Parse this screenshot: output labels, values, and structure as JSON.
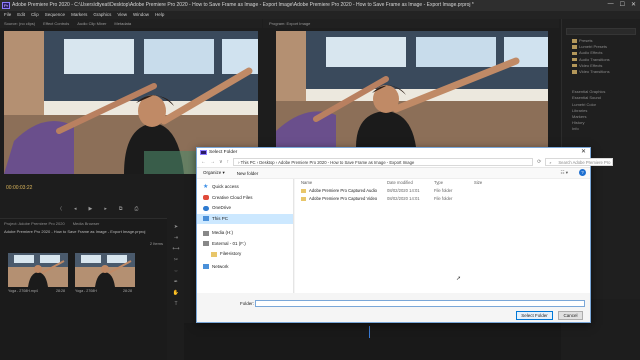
{
  "window": {
    "title": "Adobe Premiere Pro 2020 - C:\\Users\\dtyeat\\Desktop\\Adobe Premiere Pro 2020 - How to Save Frame as Image - Export Image\\Adobe Premiere Pro 2020 - How to Save Frame as Image - Export Image.prproj *",
    "app_icon": "Pr",
    "controls": [
      "—",
      "☐",
      "✕"
    ]
  },
  "menu": [
    "File",
    "Edit",
    "Clip",
    "Sequence",
    "Markers",
    "Graphics",
    "View",
    "Window",
    "Help"
  ],
  "source_monitor": {
    "tabs": [
      "Source: (no clips)",
      "Effect Controls",
      "Audio Clip Mixer",
      "Metadata"
    ],
    "timecode": "00:00:03:22"
  },
  "program_monitor": {
    "tabs": [
      "Program: Export Image"
    ]
  },
  "effects_panel": {
    "items": [
      "Presets",
      "Lumetri Presets",
      "Audio Effects",
      "Audio Transitions",
      "Video Effects",
      "Video Transitions"
    ],
    "lower_items": [
      "Essential Graphics",
      "Essential Sound",
      "Lumetri Color",
      "Libraries",
      "Markers",
      "History",
      "Info"
    ]
  },
  "project_panel": {
    "tabs": [
      "Project: Adobe Premiere Pro 2020",
      "Media Browser"
    ],
    "file": "Adobe Premiere Pro 2020 - How to Save Frame as Image - Export Image.prproj",
    "count": "2 Items",
    "thumbs": [
      {
        "name": "Yoga - 2708H.mp4",
        "duration": "28:28"
      },
      {
        "name": "Yoga - 2708H",
        "duration": "28:28"
      }
    ]
  },
  "dialog": {
    "title": "Select Folder",
    "nav_buttons": [
      "←",
      "→",
      "∨",
      "↑"
    ],
    "address": "›  This PC  ›  Desktop  ›  Adobe Premiere Pro 2020 - How to Save Frame as Image - Export Image",
    "search_placeholder": "Search Adobe Premiere Pro 2...",
    "organize": "Organize ▾",
    "new_folder": "New folder",
    "nav_items": [
      {
        "label": "Quick access",
        "icon_color": "#3a8ee6"
      },
      {
        "label": "Creative Cloud Files",
        "icon_color": "#e04a3a"
      },
      {
        "label": "OneDrive",
        "icon_color": "#2f7bd0"
      },
      {
        "label": "This PC",
        "icon_color": "#4a90d9"
      },
      {
        "label": "Media (H:)",
        "icon_color": "#888888"
      },
      {
        "label": "External - 01 (F:)",
        "icon_color": "#888888"
      },
      {
        "label": "FileHistory",
        "icon_color": "#e8c66a"
      },
      {
        "label": "Network",
        "icon_color": "#4a90d9"
      }
    ],
    "columns": [
      "Name",
      "Date modified",
      "Type",
      "Size"
    ],
    "files": [
      {
        "name": "Adobe Premiere Pro Captured Audio",
        "date": "08/02/2020 14:01",
        "type": "File folder",
        "size": ""
      },
      {
        "name": "Adobe Premiere Pro Captured Video",
        "date": "08/02/2020 14:01",
        "type": "File folder",
        "size": ""
      }
    ],
    "folder_label": "Folder:",
    "folder_value": "",
    "select_button": "Select Folder",
    "cancel_button": "Cancel"
  }
}
